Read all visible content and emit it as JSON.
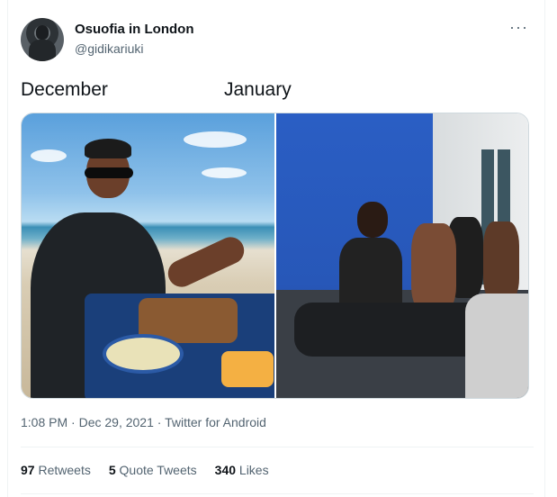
{
  "author": {
    "display_name": "Osuofia in London",
    "handle": "@gidikariuki"
  },
  "more_label": "···",
  "tweet": {
    "left_caption": "December",
    "right_caption": "January"
  },
  "media": {
    "photos": [
      {
        "icon": "photo-beach-restaurant"
      },
      {
        "icon": "photo-police-cell"
      }
    ]
  },
  "meta": {
    "time": "1:08 PM",
    "separator": "·",
    "date": "Dec 29, 2021",
    "source": "Twitter for Android"
  },
  "stats": {
    "retweets_count": "97",
    "retweets_label": "Retweets",
    "quotes_count": "5",
    "quotes_label": "Quote Tweets",
    "likes_count": "340",
    "likes_label": "Likes"
  },
  "colors": {
    "text_primary": "#0f1419",
    "text_secondary": "#536471",
    "border": "#eff3f4"
  }
}
